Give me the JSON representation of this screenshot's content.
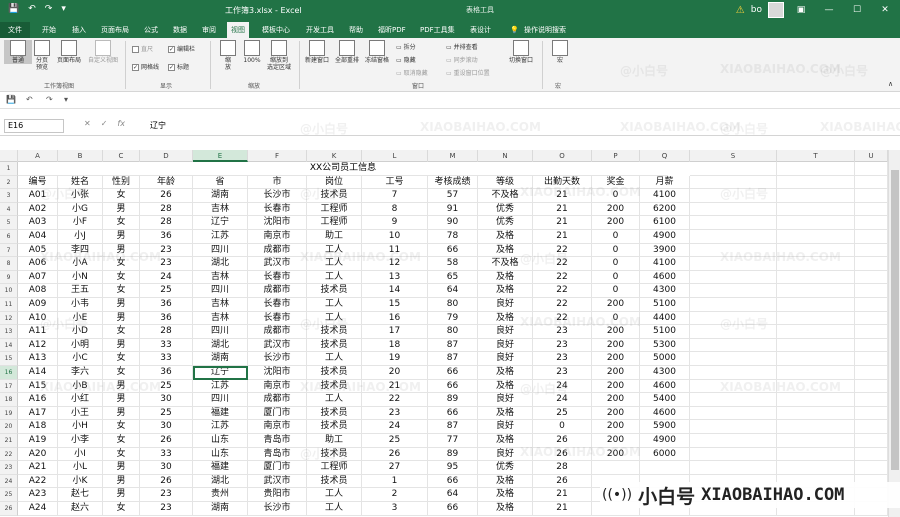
{
  "window": {
    "title": "工作簿3.xlsx - Excel",
    "context_tools": "表格工具",
    "user": "bo",
    "warn_icon": "⚠",
    "qat": [
      "💾",
      "↶",
      "↷",
      "▾"
    ]
  },
  "tabs": [
    "文件",
    "开始",
    "插入",
    "页面布局",
    "公式",
    "数据",
    "审阅",
    "视图",
    "模板中心",
    "开发工具",
    "帮助",
    "福昕PDF",
    "PDF工具集",
    "表设计",
    "💡",
    "操作说明搜索"
  ],
  "active_tab": "视图",
  "ribbon": {
    "workbook_views": {
      "label": "工作簿视图",
      "normal": "普通",
      "page_break": "分页\n预览",
      "page_layout": "页面布局",
      "custom": "自定义视图"
    },
    "show": {
      "label": "显示",
      "ruler": "直尺",
      "formula_bar": "编辑栏",
      "gridlines": "网格线",
      "headings": "标题"
    },
    "zoom": {
      "label": "缩放",
      "zoom": "缩\n放",
      "zoom100": "100%",
      "zoom_sel": "缩放到\n选定区域"
    },
    "window": {
      "label": "窗口",
      "new": "新建窗口",
      "arrange": "全部重排",
      "freeze": "冻结窗格",
      "split": "拆分",
      "hide": "隐藏",
      "unhide": "取消隐藏",
      "side_by_side": "并排查看",
      "sync": "同步滚动",
      "reset": "重设窗口位置",
      "switch": "切换窗口"
    },
    "macro": {
      "label": "宏",
      "btn": "宏"
    }
  },
  "namebox": "E16",
  "formula_value": "辽宁",
  "columns": [
    "A",
    "B",
    "C",
    "D",
    "E",
    "F",
    "K",
    "L",
    "M",
    "N",
    "O",
    "P",
    "Q",
    "S",
    "T",
    "U"
  ],
  "sheet_title": "XX公司员工信息",
  "headers": [
    "编号",
    "姓名",
    "性别",
    "年龄",
    "省",
    "市",
    "岗位",
    "工号",
    "考核成绩",
    "等级",
    "出勤天数",
    "奖金",
    "月薪"
  ],
  "rows": [
    [
      "A01",
      "小张",
      "女",
      "26",
      "湖南",
      "长沙市",
      "技术员",
      "7",
      "57",
      "不及格",
      "21",
      "0",
      "4100"
    ],
    [
      "A02",
      "小G",
      "男",
      "28",
      "吉林",
      "长春市",
      "工程师",
      "8",
      "91",
      "优秀",
      "21",
      "200",
      "6200"
    ],
    [
      "A03",
      "小F",
      "女",
      "28",
      "辽宁",
      "沈阳市",
      "工程师",
      "9",
      "90",
      "优秀",
      "21",
      "200",
      "6100"
    ],
    [
      "A04",
      "小J",
      "男",
      "36",
      "江苏",
      "南京市",
      "助工",
      "10",
      "78",
      "及格",
      "21",
      "0",
      "4900"
    ],
    [
      "A05",
      "李四",
      "男",
      "23",
      "四川",
      "成都市",
      "工人",
      "11",
      "66",
      "及格",
      "22",
      "0",
      "3900"
    ],
    [
      "A06",
      "小A",
      "女",
      "23",
      "湖北",
      "武汉市",
      "工人",
      "12",
      "58",
      "不及格",
      "22",
      "0",
      "4100"
    ],
    [
      "A07",
      "小N",
      "女",
      "24",
      "吉林",
      "长春市",
      "工人",
      "13",
      "65",
      "及格",
      "22",
      "0",
      "4600"
    ],
    [
      "A08",
      "王五",
      "女",
      "25",
      "四川",
      "成都市",
      "技术员",
      "14",
      "64",
      "及格",
      "22",
      "0",
      "4300"
    ],
    [
      "A09",
      "小韦",
      "男",
      "36",
      "吉林",
      "长春市",
      "工人",
      "15",
      "80",
      "良好",
      "22",
      "200",
      "5100"
    ],
    [
      "A10",
      "小E",
      "男",
      "36",
      "吉林",
      "长春市",
      "工人",
      "16",
      "79",
      "及格",
      "22",
      "0",
      "4400"
    ],
    [
      "A11",
      "小D",
      "女",
      "28",
      "四川",
      "成都市",
      "技术员",
      "17",
      "80",
      "良好",
      "23",
      "200",
      "5100"
    ],
    [
      "A12",
      "小明",
      "男",
      "33",
      "湖北",
      "武汉市",
      "技术员",
      "18",
      "87",
      "良好",
      "23",
      "200",
      "5300"
    ],
    [
      "A13",
      "小C",
      "女",
      "33",
      "湖南",
      "长沙市",
      "工人",
      "19",
      "87",
      "良好",
      "23",
      "200",
      "5000"
    ],
    [
      "A14",
      "李六",
      "女",
      "36",
      "辽宁",
      "沈阳市",
      "技术员",
      "20",
      "66",
      "及格",
      "23",
      "200",
      "4300"
    ],
    [
      "A15",
      "小B",
      "男",
      "25",
      "江苏",
      "南京市",
      "技术员",
      "21",
      "66",
      "及格",
      "24",
      "200",
      "4600"
    ],
    [
      "A16",
      "小红",
      "男",
      "30",
      "四川",
      "成都市",
      "工人",
      "22",
      "89",
      "良好",
      "24",
      "200",
      "5400"
    ],
    [
      "A17",
      "小王",
      "男",
      "25",
      "福建",
      "厦门市",
      "技术员",
      "23",
      "66",
      "及格",
      "25",
      "200",
      "4600"
    ],
    [
      "A18",
      "小H",
      "女",
      "30",
      "江苏",
      "南京市",
      "技术员",
      "24",
      "87",
      "良好",
      "0",
      "200",
      "5900"
    ],
    [
      "A19",
      "小李",
      "女",
      "26",
      "山东",
      "青岛市",
      "助工",
      "25",
      "77",
      "及格",
      "26",
      "200",
      "4900"
    ],
    [
      "A20",
      "小I",
      "女",
      "33",
      "山东",
      "青岛市",
      "技术员",
      "26",
      "89",
      "良好",
      "26",
      "200",
      "6000"
    ],
    [
      "A21",
      "小L",
      "男",
      "30",
      "福建",
      "厦门市",
      "工程师",
      "27",
      "95",
      "优秀",
      "28",
      "",
      ""
    ],
    [
      "A22",
      "小K",
      "男",
      "26",
      "湖北",
      "武汉市",
      "技术员",
      "1",
      "66",
      "及格",
      "26",
      "",
      ""
    ],
    [
      "A23",
      "赵七",
      "男",
      "23",
      "贵州",
      "贵阳市",
      "工人",
      "2",
      "64",
      "及格",
      "21",
      "",
      ""
    ],
    [
      "A24",
      "赵六",
      "女",
      "23",
      "湖南",
      "长沙市",
      "工人",
      "3",
      "66",
      "及格",
      "21",
      "",
      ""
    ]
  ],
  "watermark": {
    "brand": "小白号",
    "url": "XIAOBAIHAO.COM",
    "tile_text": "@小白号",
    "tile_url": "XIAOBAIHAO.COM"
  }
}
